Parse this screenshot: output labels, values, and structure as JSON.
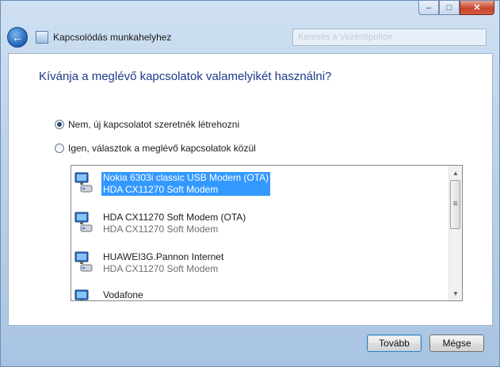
{
  "window": {
    "title": "Kapcsolódás munkahelyhez",
    "search_placeholder": "Keresés a Vezérlőpulton",
    "caption_buttons": {
      "minimize": "–",
      "maximize": "□",
      "close": "✕"
    }
  },
  "page": {
    "heading": "Kívánja a meglévő kapcsolatok valamelyikét használni?"
  },
  "options": [
    {
      "label": "Nem, új kapcsolatot szeretnék létrehozni",
      "selected": true
    },
    {
      "label": "Igen, választok a meglévő kapcsolatok közül",
      "selected": false
    }
  ],
  "connections": [
    {
      "name": "Nokia 6303i classic USB Modem (OTA)",
      "device": "HDA CX11270 Soft Modem",
      "selected": true,
      "icon": "modem-icon"
    },
    {
      "name": "HDA CX11270 Soft Modem (OTA)",
      "device": "HDA CX11270 Soft Modem",
      "selected": false,
      "icon": "modem-icon"
    },
    {
      "name": "HUAWEI3G.Pannon Internet",
      "device": "HDA CX11270 Soft Modem",
      "selected": false,
      "icon": "modem-icon"
    },
    {
      "name": "Vodafone",
      "device": "",
      "selected": false,
      "icon": "modem-icon"
    }
  ],
  "buttons": {
    "next": "Tovább",
    "cancel": "Mégse"
  },
  "colors": {
    "heading": "#1e3a8a",
    "selection": "#3399ff",
    "close_button": "#c8452d"
  }
}
